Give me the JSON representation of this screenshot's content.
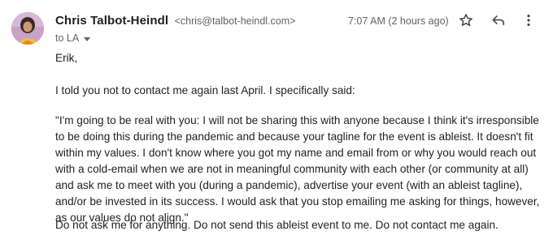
{
  "header": {
    "sender_name": "Chris Talbot-Heindl",
    "sender_email": "<chris@talbot-heindl.com>",
    "recipient": "to LA",
    "timestamp": "7:07 AM (2 hours ago)"
  },
  "icons": {
    "star": "star-outline-icon",
    "reply": "reply-arrow-icon",
    "more": "more-vert-icon"
  },
  "body": {
    "greeting": "Erik,",
    "intro": "I told you not to contact me again last April. I specifically said:",
    "quote": "\"I'm going to be real with you: I will not be sharing this with anyone because I think it's irresponsible to be doing this during the pandemic and because your tagline for the event is ableist. It doesn't fit within my values. I don't know where you got my name and email from or why you would reach out with a cold-email when we are not in meaningful community with each other (or community at all) and ask me to meet with you (during a pandemic), advertise your event (with an ableist tagline), and/or be invested in its success. I would ask that you stop emailing me asking for things, however, as our values do not align.\"",
    "closing": "Do not ask me for anything. Do not send this ableist event to me. Do not contact me again."
  },
  "colors": {
    "icon": "#444746",
    "secondary_text": "#5f6368"
  }
}
